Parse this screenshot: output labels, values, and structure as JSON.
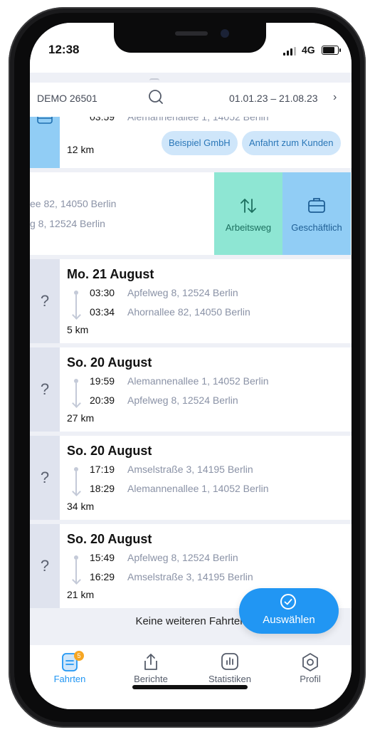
{
  "status_bar": {
    "time": "12:38",
    "network": "4G"
  },
  "header": {
    "vehicle": "DEMO 26501",
    "date_range": "01.01.23 – 21.08.23"
  },
  "partial_trip_top": {
    "time": "03:59",
    "address": "Alemannenallee 1, 14052 Berlin",
    "distance": "12 km",
    "tags": [
      "Beispiel GmbH",
      "Anfahrt zum Kunden"
    ]
  },
  "swiped_trip": {
    "address_from": "ee 82, 14050 Berlin",
    "address_to": "g 8, 12524 Berlin",
    "actions": [
      {
        "label": "Arbeitsweg",
        "icon": "swap-vertical-icon",
        "color": "#8ee6d3"
      },
      {
        "label": "Geschäftlich",
        "icon": "briefcase-icon",
        "color": "#91cdf5"
      }
    ]
  },
  "trips": [
    {
      "status": "?",
      "date": "Mo. 21 August",
      "start_time": "03:30",
      "start_address": "Apfelweg 8, 12524 Berlin",
      "end_time": "03:34",
      "end_address": "Ahornallee 82, 14050 Berlin",
      "distance": "5 km"
    },
    {
      "status": "?",
      "date": "So. 20 August",
      "start_time": "19:59",
      "start_address": "Alemannenallee 1, 14052 Berlin",
      "end_time": "20:39",
      "end_address": "Apfelweg 8, 12524 Berlin",
      "distance": "27 km"
    },
    {
      "status": "?",
      "date": "So. 20 August",
      "start_time": "17:19",
      "start_address": "Amselstraße 3, 14195 Berlin",
      "end_time": "18:29",
      "end_address": "Alemannenallee 1, 14052 Berlin",
      "distance": "34 km"
    },
    {
      "status": "?",
      "date": "So. 20 August",
      "start_time": "15:49",
      "start_address": "Apfelweg 8, 12524 Berlin",
      "end_time": "16:29",
      "end_address": "Amselstraße 3, 14195 Berlin",
      "distance": "21 km"
    }
  ],
  "footer_message": "Keine weiteren Fahrten",
  "fab": {
    "label": "Auswählen",
    "icon": "check-circle-icon"
  },
  "tabs": [
    {
      "label": "Fahrten",
      "icon": "document-icon",
      "badge": "5",
      "active": true
    },
    {
      "label": "Berichte",
      "icon": "share-icon",
      "active": false
    },
    {
      "label": "Statistiken",
      "icon": "bar-chart-icon",
      "active": false
    },
    {
      "label": "Profil",
      "icon": "hexagon-icon",
      "active": false
    }
  ],
  "colors": {
    "accent": "#2196f3",
    "unclassified": "#dfe3ee",
    "tag_bg": "#cfe6fa",
    "commute": "#8ee6d3",
    "business": "#91cdf5"
  }
}
